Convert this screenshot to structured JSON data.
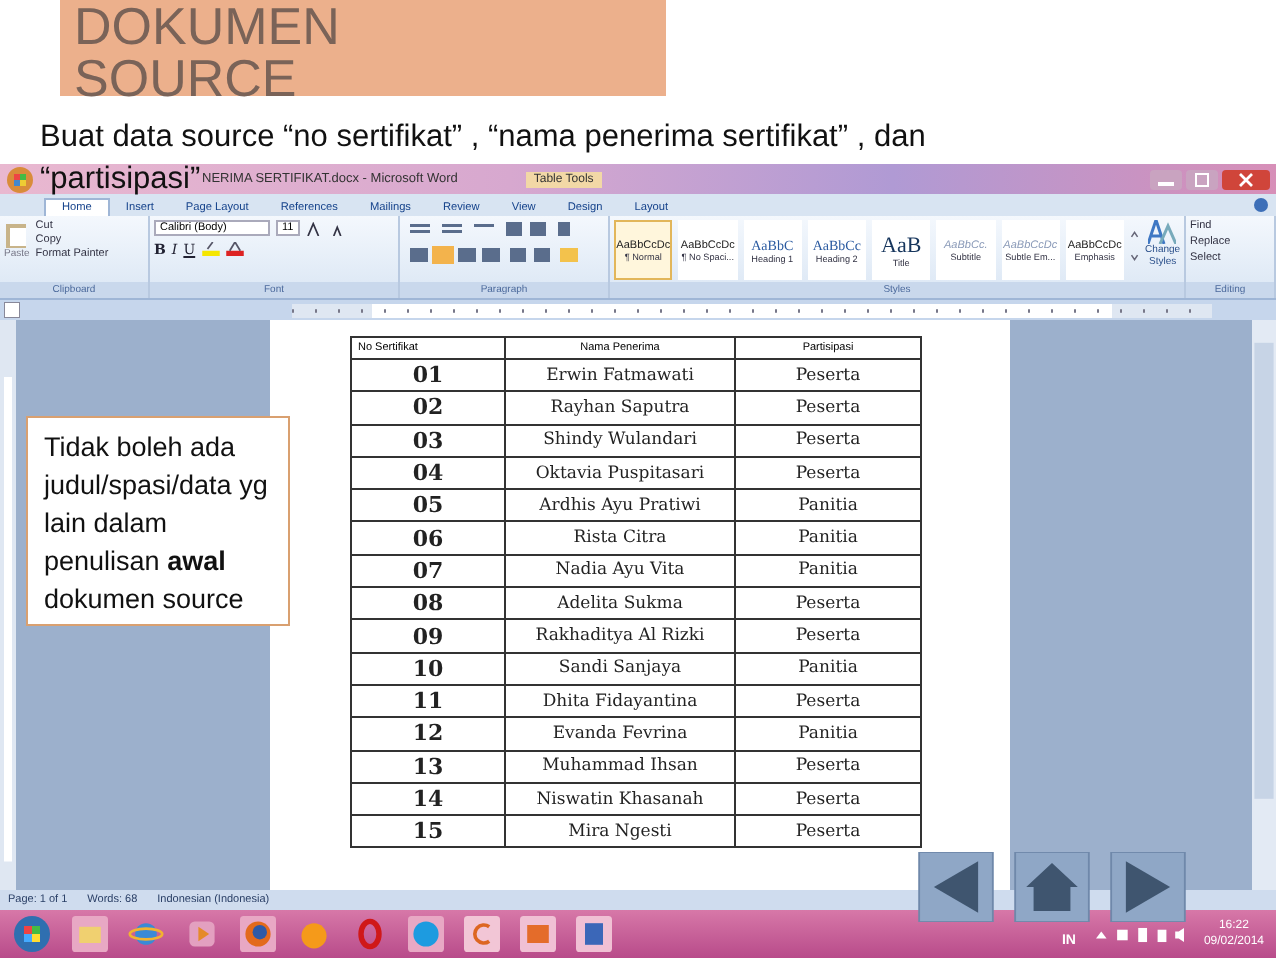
{
  "slide": {
    "title": "DOKUMEN SOURCE",
    "instruction_lines": [
      "Buat data source “no sertifikat” , “nama penerima sertifikat” , dan",
      "“partisipasi”"
    ],
    "callout": "Tidak boleh ada judul/spasi/data yg lain dalam penulisan **awal** dokumen source"
  },
  "window": {
    "title": "NERIMA SERTIFIKAT.docx - Microsoft Word",
    "contextual_tab": "Table Tools"
  },
  "tabs": [
    {
      "label": "Home",
      "selected": true
    },
    {
      "label": "Insert",
      "selected": false
    },
    {
      "label": "Page Layout",
      "selected": false
    },
    {
      "label": "References",
      "selected": false
    },
    {
      "label": "Mailings",
      "selected": false
    },
    {
      "label": "Review",
      "selected": false
    },
    {
      "label": "View",
      "selected": false
    },
    {
      "label": "Design",
      "selected": false
    },
    {
      "label": "Layout",
      "selected": false
    }
  ],
  "clipboard": {
    "label": "Clipboard",
    "paste": "Paste",
    "items": [
      "Cut",
      "Copy",
      "Format Painter"
    ]
  },
  "font": {
    "label": "Font",
    "family": "Calibri (Body)",
    "size": "11",
    "format_buttons": [
      "B",
      "I",
      "U"
    ]
  },
  "paragraph": {
    "label": "Paragraph"
  },
  "styles": {
    "label": "Styles",
    "change": "Change Styles",
    "items": [
      {
        "preview": "AaBbCcDc",
        "name": "¶ Normal",
        "kind": "body",
        "selected": true
      },
      {
        "preview": "AaBbCcDc",
        "name": "¶ No Spaci...",
        "kind": "body",
        "selected": false
      },
      {
        "preview": "AaBbC",
        "name": "Heading 1",
        "kind": "heading",
        "selected": false
      },
      {
        "preview": "AaBbCc",
        "name": "Heading 2",
        "kind": "heading",
        "selected": false
      },
      {
        "preview": "AaB",
        "name": "Title",
        "kind": "title",
        "selected": false
      },
      {
        "preview": "AaBbCc.",
        "name": "Subtitle",
        "kind": "subtle",
        "selected": false
      },
      {
        "preview": "AaBbCcDc",
        "name": "Subtle Em...",
        "kind": "subtle",
        "selected": false
      },
      {
        "preview": "AaBbCcDc",
        "name": "Emphasis",
        "kind": "body",
        "selected": false
      }
    ]
  },
  "editing": {
    "label": "Editing",
    "items": [
      "Find",
      "Replace",
      "Select"
    ]
  },
  "table": {
    "columns": [
      "No Sertifikat",
      "Nama Penerima",
      "Partisipasi"
    ],
    "rows": [
      [
        "01",
        "Erwin Fatmawati",
        "Peserta"
      ],
      [
        "02",
        "Rayhan Saputra",
        "Peserta"
      ],
      [
        "03",
        "Shindy Wulandari",
        "Peserta"
      ],
      [
        "04",
        "Oktavia Puspitasari",
        "Peserta"
      ],
      [
        "05",
        "Ardhis Ayu Pratiwi",
        "Panitia"
      ],
      [
        "06",
        "Rista Citra",
        "Panitia"
      ],
      [
        "07",
        "Nadia Ayu Vita",
        "Panitia"
      ],
      [
        "08",
        "Adelita Sukma",
        "Peserta"
      ],
      [
        "09",
        "Rakhaditya Al Rizki",
        "Peserta"
      ],
      [
        "10",
        "Sandi Sanjaya",
        "Panitia"
      ],
      [
        "11",
        "Dhita Fidayantina",
        "Peserta"
      ],
      [
        "12",
        "Evanda Fevrina",
        "Panitia"
      ],
      [
        "13",
        "Muhammad Ihsan",
        "Peserta"
      ],
      [
        "14",
        "Niswatin Khasanah",
        "Peserta"
      ],
      [
        "15",
        "Mira Ngesti",
        "Peserta"
      ]
    ]
  },
  "status_bar": [
    "Page: 1 of 1",
    "Words: 68",
    "Indonesian (Indonesia)"
  ],
  "taskbar": {
    "language": "IN",
    "time": "16:22",
    "date": "09/02/2014"
  }
}
